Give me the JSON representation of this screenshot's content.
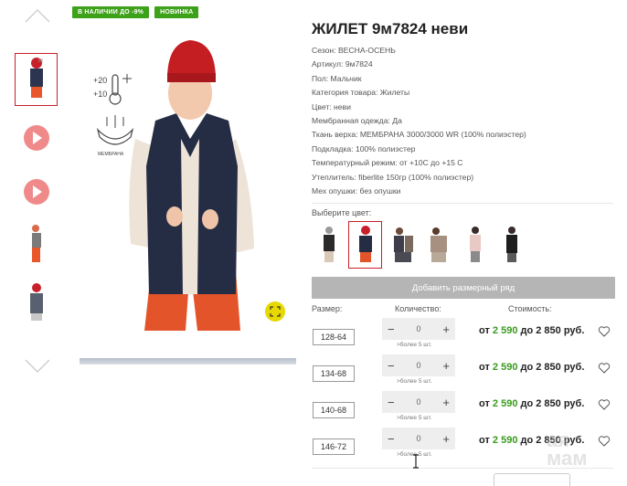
{
  "badges": [
    "В НАЛИЧИИ ДО -9%",
    "НОВИНКА"
  ],
  "product": {
    "title": "ЖИЛЕТ 9м7824 неви",
    "specs": [
      "Сезон: ВЕСНА-ОСЕНЬ",
      "Артикул: 9м7824",
      "Пол: Мальчик",
      "Категория товара: Жилеты",
      "Цвет: неви",
      "Мембранная одежда: Да",
      "Ткань верха: МЕМБРАНА 3000/3000 WR (100% полиэстер)",
      "Подкладка: 100% полиэстер",
      "Температурный режим: от +10С до +15 С",
      "Утеплитель: fiberlite 150гр (100% полиэстер)",
      "Мех опушки: без опушки"
    ]
  },
  "photo_icons": {
    "temp_top": "+20",
    "temp_bottom": "+10",
    "membrane": "МЕМБРАНА"
  },
  "color": {
    "label": "Выберите цвет:"
  },
  "add_size_row": "Добавить размерный ряд",
  "columns": {
    "size": "Размер:",
    "qty": "Количество:",
    "cost": "Стоимость:"
  },
  "rows": [
    {
      "size": "128-64",
      "qty": "0",
      "avail": ">более 5 шт.",
      "from": "от",
      "price_from": "2 590",
      "to": "до 2 850 руб."
    },
    {
      "size": "134-68",
      "qty": "0",
      "avail": ">более 5 шт.",
      "from": "от",
      "price_from": "2 590",
      "to": "до 2 850 руб."
    },
    {
      "size": "140-68",
      "qty": "0",
      "avail": ">более 5 шт.",
      "from": "от",
      "price_from": "2 590",
      "to": "до 2 850 руб."
    },
    {
      "size": "146-72",
      "qty": "0",
      "avail": ">более 5 шт.",
      "from": "от",
      "price_from": "2 590",
      "to": "до 2 850 руб."
    }
  ],
  "stepper": {
    "minus": "−",
    "plus": "+"
  },
  "watermark": [
    "ая",
    "мам"
  ],
  "colors_hex": {
    "badge": "#3ea11a",
    "price": "#3a9a1f",
    "active_border": "#c8202a"
  }
}
